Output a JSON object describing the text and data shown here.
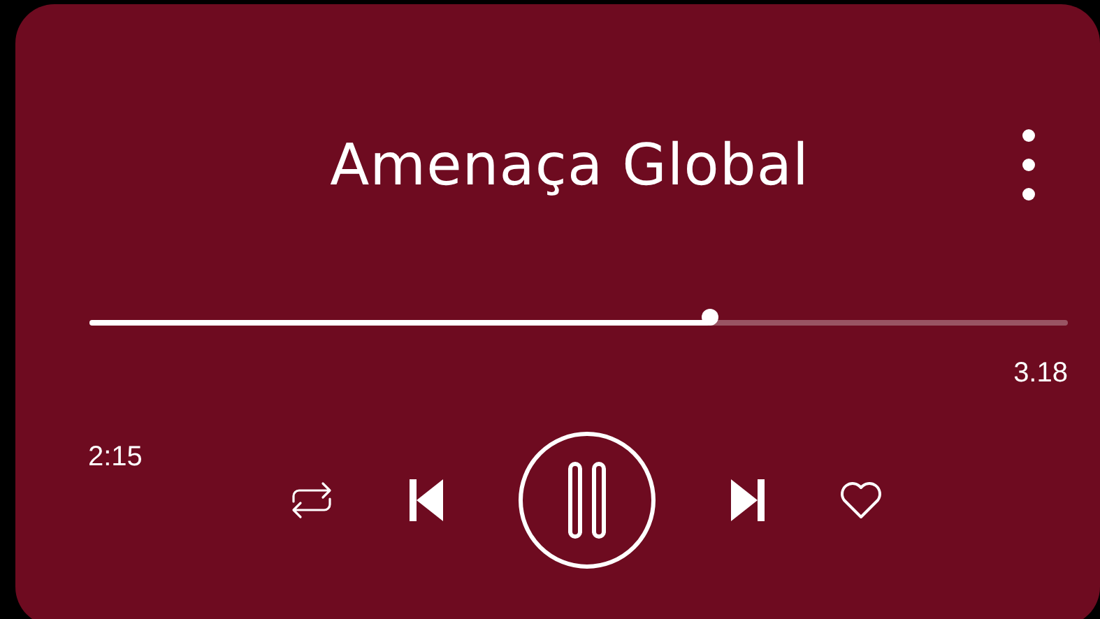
{
  "track": {
    "title": "Amenaça Global"
  },
  "progress": {
    "level": 0.634,
    "elapsed": "2:15",
    "duration": "3.18"
  },
  "player": {
    "playing": true,
    "liked": false
  }
}
